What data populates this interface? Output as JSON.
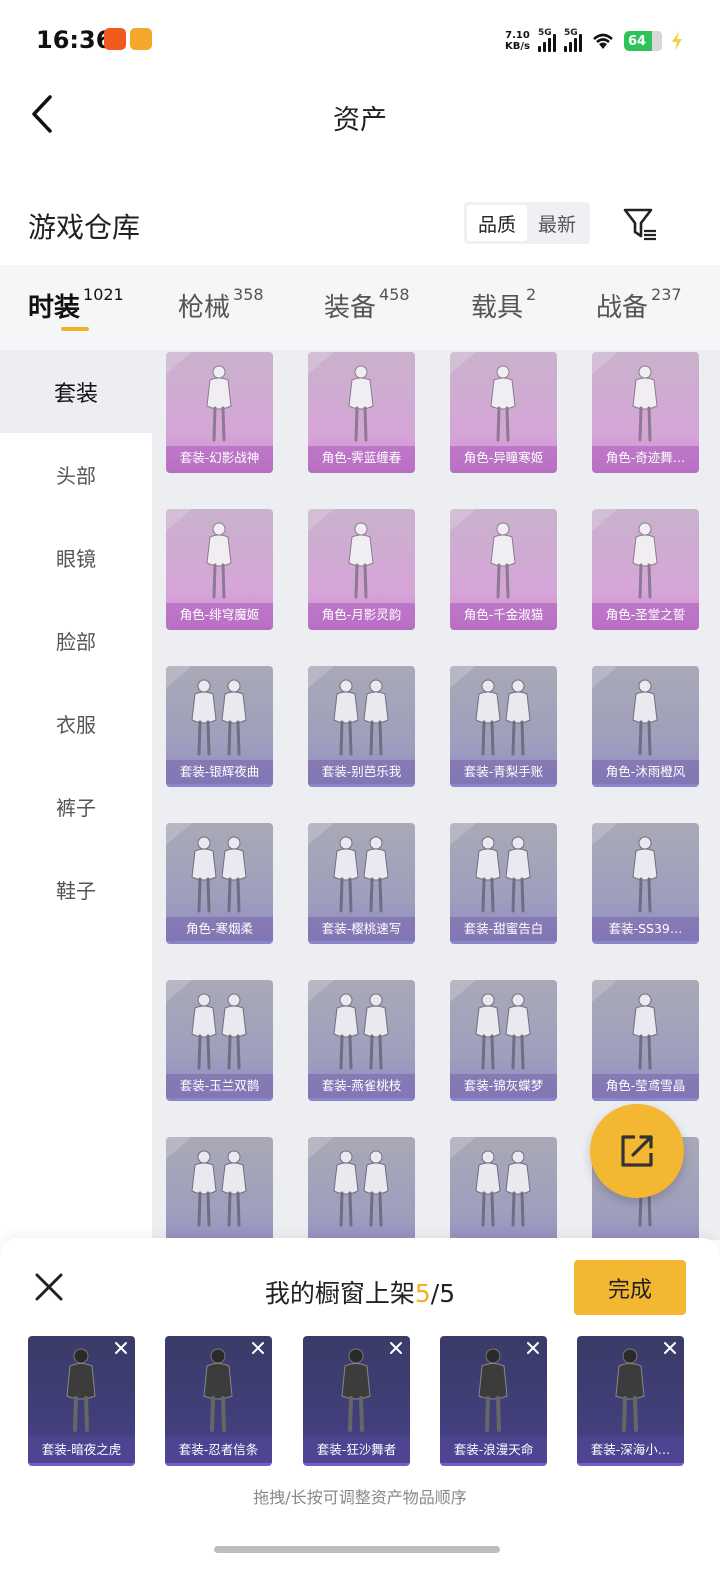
{
  "status_bar": {
    "time": "16:36",
    "net_speed_value": "7.10",
    "net_speed_unit": "KB/s",
    "signal1_label": "5G",
    "signal2_label": "5G",
    "battery": "64",
    "app_badge_colors": [
      "#f25a1c",
      "#f3a82c"
    ]
  },
  "header": {
    "title": "资产",
    "back_icon": "chevron-left-icon"
  },
  "section": {
    "title": "游戏仓库",
    "sort_quality": "品质",
    "sort_latest": "最新",
    "filter_icon": "filter-icon"
  },
  "tabs": [
    {
      "label": "时装",
      "count": "1021"
    },
    {
      "label": "枪械",
      "count": "358"
    },
    {
      "label": "装备",
      "count": "458"
    },
    {
      "label": "载具",
      "count": "2"
    },
    {
      "label": "战备",
      "count": "237"
    }
  ],
  "sidebar": [
    "套装",
    "头部",
    "眼镜",
    "脸部",
    "衣服",
    "裤子",
    "鞋子"
  ],
  "items": [
    "套装-幻影战神",
    "角色-霁蓝缠春",
    "角色-异瞳寒姬",
    "角色-奇迹舞…",
    "角色-绯穹魔姬",
    "角色-月影灵韵",
    "角色-千金淑猫",
    "角色-圣堂之誓",
    "套装-银辉夜曲",
    "套装-别芭乐我",
    "套装-青梨手账",
    "角色-沐雨橙风",
    "角色-寒烟柔",
    "套装-樱桃速写",
    "套装-甜蜜告白",
    "套装-SS39…",
    "套装-玉兰双鹊",
    "套装-燕雀桃枝",
    "套装-锦灰蝶梦",
    "角色-莹鸢雪晶",
    "",
    "",
    "",
    ""
  ],
  "sheet": {
    "title_prefix": "我的橱窗上架",
    "count": "5",
    "total": "/5",
    "done_label": "完成",
    "hint": "拖拽/长按可调整资产物品顺序",
    "selected": [
      "套装-暗夜之虎",
      "套装-忍者信条",
      "套装-狂沙舞者",
      "套装-浪漫天命",
      "套装-深海小…"
    ]
  },
  "colors": {
    "accent": "#f4b731",
    "rare_pink": "#cc8bd0",
    "rare_blue": "#8f8cc4",
    "selected_bg": "#403e78"
  }
}
